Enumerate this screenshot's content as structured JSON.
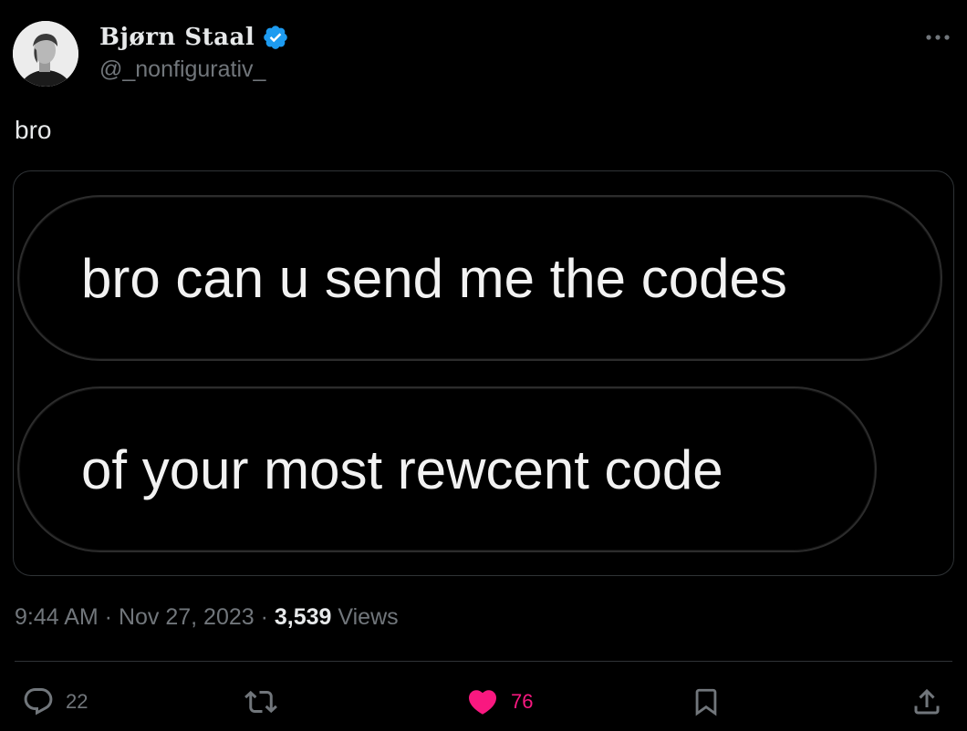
{
  "user": {
    "display_name": "Bjørn Staal",
    "handle": "@_nonfigurativ_",
    "verified": true,
    "avatar_icon": "profile-photo"
  },
  "tweet": {
    "text": "bro",
    "media": {
      "bubble_1": "bro can u send me the codes",
      "bubble_2": "of your most rewcent code"
    }
  },
  "meta": {
    "time": "9:44 AM",
    "separator_1": " · ",
    "date": "Nov 27, 2023",
    "separator_2": " · ",
    "views_count": "3,539",
    "views_label": "Views"
  },
  "actions": {
    "reply_count": "22",
    "retweet_count": "",
    "like_count": "76",
    "liked": true
  },
  "colors": {
    "background": "#000000",
    "text": "#e7e9ea",
    "muted": "#71767b",
    "verified": "#1d9bf0",
    "like": "#f91880",
    "border": "#2f3336"
  },
  "icons": {
    "more": "more-dots-icon",
    "verified": "verified-badge-icon",
    "reply": "reply-icon",
    "retweet": "retweet-icon",
    "like": "heart-icon",
    "bookmark": "bookmark-icon",
    "share": "share-icon"
  }
}
